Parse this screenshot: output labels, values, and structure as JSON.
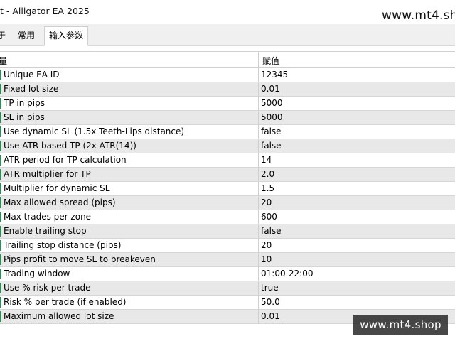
{
  "window": {
    "title": "t - Alligator EA 2025"
  },
  "watermark": {
    "top": "www.mt4.sh",
    "bottom": "www.mt4.shop"
  },
  "tabs": [
    {
      "label": "于"
    },
    {
      "label": "常用"
    },
    {
      "label": "输入参数",
      "active": true
    }
  ],
  "table": {
    "headers": {
      "variable": "量",
      "value": "赋值"
    },
    "rows": [
      {
        "name": "Unique EA ID",
        "value": "12345"
      },
      {
        "name": "Fixed lot size",
        "value": "0.01"
      },
      {
        "name": "TP in pips",
        "value": "5000"
      },
      {
        "name": "SL in pips",
        "value": "5000"
      },
      {
        "name": "Use dynamic SL (1.5x Teeth-Lips distance)",
        "value": "false"
      },
      {
        "name": "Use ATR-based TP (2x ATR(14))",
        "value": "false"
      },
      {
        "name": "ATR period for TP calculation",
        "value": "14"
      },
      {
        "name": "ATR multiplier for TP",
        "value": "2.0"
      },
      {
        "name": "Multiplier for dynamic SL",
        "value": "1.5"
      },
      {
        "name": "Max allowed spread (pips)",
        "value": "20"
      },
      {
        "name": "Max trades per zone",
        "value": "600"
      },
      {
        "name": "Enable trailing stop",
        "value": "false"
      },
      {
        "name": "Trailing stop distance (pips)",
        "value": "20"
      },
      {
        "name": "Pips profit to move SL to breakeven",
        "value": "10"
      },
      {
        "name": "Trading window",
        "value": "01:00-22:00"
      },
      {
        "name": "Use % risk per trade",
        "value": "true"
      },
      {
        "name": "Risk % per trade (if enabled)",
        "value": "50.0"
      },
      {
        "name": "Maximum allowed lot size",
        "value": "0.01"
      }
    ]
  },
  "colors": {
    "row_alt": "#e8e8e8",
    "row_marker": "#2e8b57",
    "tab_bg": "#f0f0f0"
  }
}
